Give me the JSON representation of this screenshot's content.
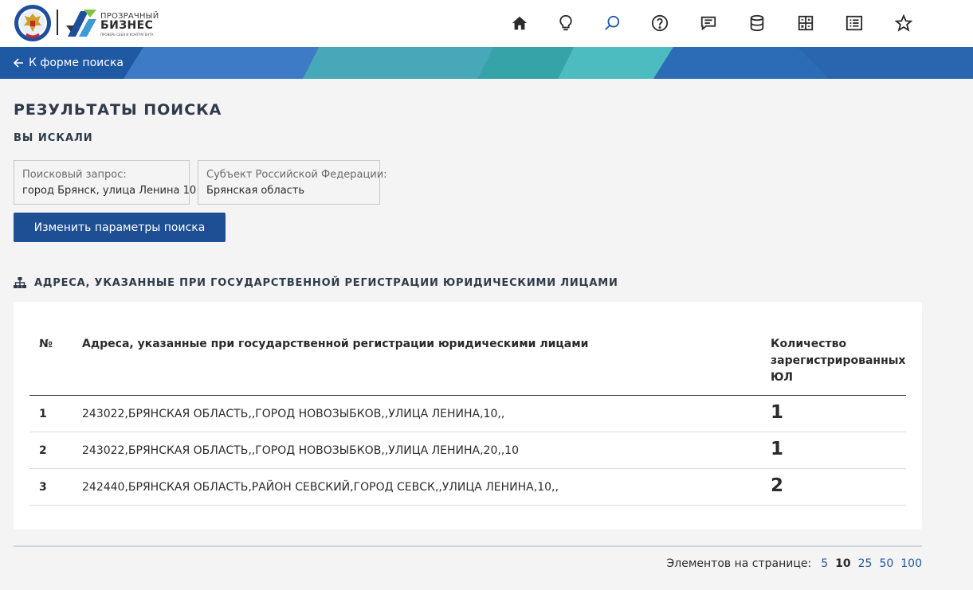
{
  "header": {
    "logo": {
      "text_top": "ПРОЗРАЧНЫЙ",
      "text_main": "БИЗНЕС",
      "text_sub": "ПРОВЕРЬ СЕБЯ И КОНТРАГЕНТА"
    },
    "nav_icons": [
      "home-icon",
      "lightbulb-icon",
      "search-icon",
      "help-icon",
      "chat-icon",
      "database-icon",
      "calculator-icon",
      "list-icon",
      "star-icon"
    ],
    "active_icon": "search-icon",
    "colors": {
      "icon": "#2b2b2b",
      "active_icon": "#1e5aa8"
    }
  },
  "banner": {
    "back_label": "К форме поиска",
    "color": "#2a65ad"
  },
  "main": {
    "title": "РЕЗУЛЬТАТЫ ПОИСКА",
    "subtitle": "ВЫ ИСКАЛИ",
    "filters": [
      {
        "label": "Поисковый запрос:",
        "value": "город Брянск, улица Ленина 10"
      },
      {
        "label": "Субъект Российской Федерации:",
        "value": "Брянская область"
      }
    ],
    "change_button": "Изменить параметры поиска",
    "section_title": "АДРЕСА, УКАЗАННЫЕ ПРИ ГОСУДАРСТВЕННОЙ РЕГИСТРАЦИИ ЮРИДИЧЕСКИМИ ЛИЦАМИ"
  },
  "table": {
    "columns": {
      "num": "№",
      "address": "Адреса, указанные при государственной регистрации юридическими лицами",
      "count_line1": "Количество",
      "count_line2": "зарегистрированных",
      "count_line3": "ЮЛ"
    },
    "rows": [
      {
        "num": "1",
        "address": "243022,БРЯНСКАЯ ОБЛАСТЬ,,ГОРОД НОВОЗЫБКОВ,,УЛИЦА ЛЕНИНА,10,,",
        "count": "1"
      },
      {
        "num": "2",
        "address": "243022,БРЯНСКАЯ ОБЛАСТЬ,,ГОРОД НОВОЗЫБКОВ,,УЛИЦА ЛЕНИНА,20,,10",
        "count": "1"
      },
      {
        "num": "3",
        "address": "242440,БРЯНСКАЯ ОБЛАСТЬ,РАЙОН СЕВСКИЙ,ГОРОД СЕВСК,,УЛИЦА ЛЕНИНА,10,,",
        "count": "2"
      }
    ]
  },
  "pager": {
    "label": "Элементов на странице:",
    "options": [
      "5",
      "10",
      "25",
      "50",
      "100"
    ],
    "selected": "10"
  }
}
